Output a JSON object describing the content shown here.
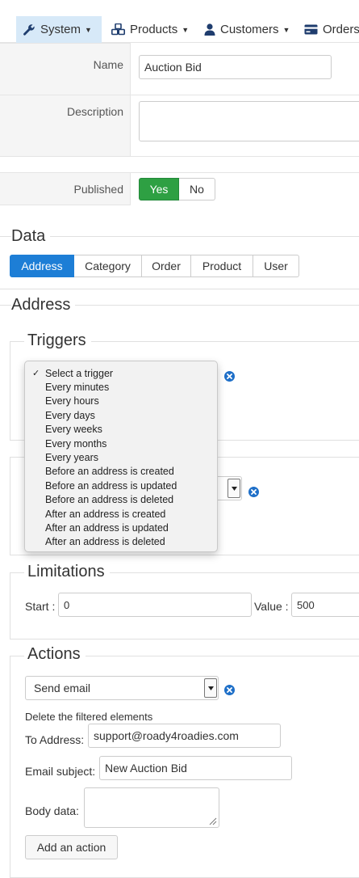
{
  "nav": {
    "items": [
      {
        "label": "System",
        "icon": "wrench-icon",
        "active": true,
        "caret": true
      },
      {
        "label": "Products",
        "icon": "cubes-icon",
        "active": false,
        "caret": true
      },
      {
        "label": "Customers",
        "icon": "user-icon",
        "active": false,
        "caret": true
      },
      {
        "label": "Orders",
        "icon": "credit-card-icon",
        "active": false,
        "caret": false
      }
    ]
  },
  "form": {
    "name_label": "Name",
    "name_value": "Auction Bid",
    "description_label": "Description",
    "description_value": "",
    "published_label": "Published",
    "published_yes": "Yes",
    "published_no": "No",
    "published_selected": "Yes"
  },
  "data_section": {
    "title": "Data",
    "tabs": [
      "Address",
      "Category",
      "Order",
      "Product",
      "User"
    ],
    "active_tab": "Address"
  },
  "address_section": {
    "title": "Address",
    "triggers": {
      "title": "Triggers",
      "options": [
        "Select a trigger",
        "Every minutes",
        "Every hours",
        "Every days",
        "Every weeks",
        "Every months",
        "Every years",
        "Before an address is created",
        "Before an address is updated",
        "Before an address is deleted",
        "After an address is created",
        "After an address is updated",
        "After an address is deleted"
      ],
      "selected": "Select a trigger"
    },
    "limitations": {
      "title": "Limitations",
      "start_label": "Start :",
      "start_value": "0",
      "value_label": "Value :",
      "value_value": "500"
    },
    "actions": {
      "title": "Actions",
      "selected_action": "Send email",
      "delete_text": "Delete the filtered elements",
      "to_address_label": "To Address:",
      "to_address_value": "support@roady4roadies.com",
      "subject_label": "Email subject:",
      "subject_value": "New Auction Bid",
      "body_label": "Body data:",
      "body_value": "",
      "add_action_label": "Add an action"
    }
  },
  "colors": {
    "nav_active_bg": "#d7e9f8",
    "yes_green": "#2ea043",
    "tab_active_blue": "#1d7ed6",
    "remove_icon_blue": "#1e6fc8"
  }
}
